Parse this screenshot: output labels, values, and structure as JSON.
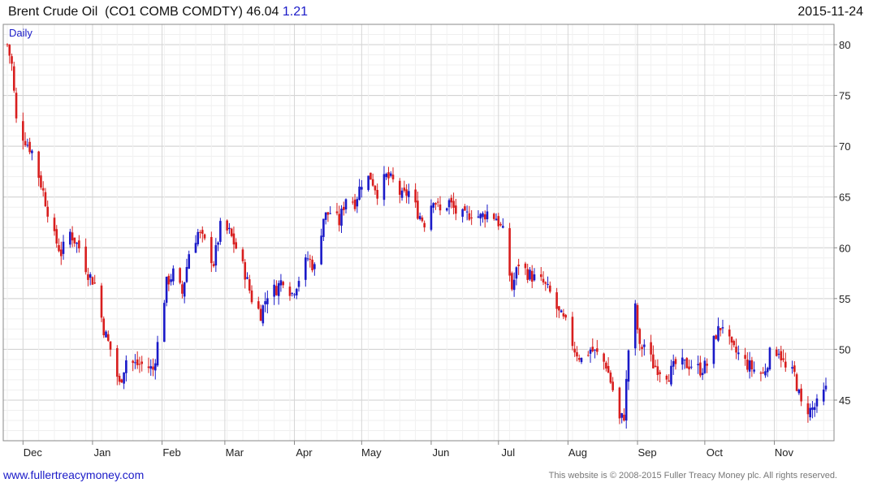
{
  "header": {
    "instrument": "Brent Crude Oil",
    "ticker": "(CO1 COMB COMDTY)",
    "last": "46.04",
    "change": "1.21",
    "date": "2015-11-24"
  },
  "footer": {
    "site": "www.fullertreacymoney.com",
    "copyright": "This website is © 2008-2015 Fuller Treacy Money plc. All rights reserved."
  },
  "colors": {
    "up": "#1a1ac8",
    "down": "#d81e1e",
    "grid": "#dddddd",
    "border": "#888888"
  },
  "chart_data": {
    "type": "candlestick",
    "interval_label": "Daily",
    "x_range": [
      "2014-11-24",
      "2015-11-24"
    ],
    "ylim": [
      41,
      82
    ],
    "yticks": [
      45,
      50,
      55,
      60,
      65,
      70,
      75,
      80
    ],
    "months": [
      {
        "label": "Dec",
        "date": "2014-12-01"
      },
      {
        "label": "Jan",
        "date": "2015-01-01"
      },
      {
        "label": "Feb",
        "date": "2015-02-01"
      },
      {
        "label": "Mar",
        "date": "2015-03-01"
      },
      {
        "label": "Apr",
        "date": "2015-04-01"
      },
      {
        "label": "May",
        "date": "2015-05-01"
      },
      {
        "label": "Jun",
        "date": "2015-06-01"
      },
      {
        "label": "Jul",
        "date": "2015-07-01"
      },
      {
        "label": "Aug",
        "date": "2015-08-01"
      },
      {
        "label": "Sep",
        "date": "2015-09-01"
      },
      {
        "label": "Oct",
        "date": "2015-10-01"
      },
      {
        "label": "Nov",
        "date": "2015-11-01"
      }
    ],
    "close_path": [
      [
        "2014-11-24",
        80.0
      ],
      [
        "2014-11-26",
        78.0
      ],
      [
        "2014-11-28",
        72.5
      ],
      [
        "2014-12-01",
        71.0
      ],
      [
        "2014-12-05",
        69.5
      ],
      [
        "2014-12-10",
        65.5
      ],
      [
        "2014-12-15",
        61.0
      ],
      [
        "2014-12-18",
        59.5
      ],
      [
        "2014-12-22",
        61.5
      ],
      [
        "2014-12-26",
        60.0
      ],
      [
        "2014-12-30",
        57.5
      ],
      [
        "2015-01-02",
        56.5
      ],
      [
        "2015-01-06",
        52.0
      ],
      [
        "2015-01-09",
        50.0
      ],
      [
        "2015-01-13",
        46.5
      ],
      [
        "2015-01-16",
        49.0
      ],
      [
        "2015-01-20",
        48.5
      ],
      [
        "2015-01-24",
        48.5
      ],
      [
        "2015-01-28",
        48.0
      ],
      [
        "2015-01-30",
        50.5
      ],
      [
        "2015-02-03",
        56.5
      ],
      [
        "2015-02-06",
        57.5
      ],
      [
        "2015-02-10",
        55.5
      ],
      [
        "2015-02-13",
        59.5
      ],
      [
        "2015-02-17",
        61.5
      ],
      [
        "2015-02-20",
        60.5
      ],
      [
        "2015-02-24",
        58.5
      ],
      [
        "2015-02-27",
        62.0
      ],
      [
        "2015-03-03",
        61.5
      ],
      [
        "2015-03-06",
        60.0
      ],
      [
        "2015-03-10",
        57.5
      ],
      [
        "2015-03-13",
        55.0
      ],
      [
        "2015-03-17",
        53.5
      ],
      [
        "2015-03-20",
        55.5
      ],
      [
        "2015-03-24",
        56.0
      ],
      [
        "2015-03-27",
        57.0
      ],
      [
        "2015-03-31",
        55.5
      ],
      [
        "2015-04-03",
        57.0
      ],
      [
        "2015-04-07",
        59.0
      ],
      [
        "2015-04-10",
        58.0
      ],
      [
        "2015-04-14",
        63.0
      ],
      [
        "2015-04-17",
        63.5
      ],
      [
        "2015-04-21",
        62.5
      ],
      [
        "2015-04-24",
        65.0
      ],
      [
        "2015-04-28",
        64.5
      ],
      [
        "2015-05-01",
        66.5
      ],
      [
        "2015-05-05",
        67.0
      ],
      [
        "2015-05-08",
        65.5
      ],
      [
        "2015-05-12",
        67.0
      ],
      [
        "2015-05-15",
        66.5
      ],
      [
        "2015-05-19",
        65.0
      ],
      [
        "2015-05-22",
        65.5
      ],
      [
        "2015-05-26",
        63.5
      ],
      [
        "2015-05-29",
        62.5
      ],
      [
        "2015-06-02",
        65.0
      ],
      [
        "2015-06-05",
        63.5
      ],
      [
        "2015-06-09",
        64.5
      ],
      [
        "2015-06-12",
        63.5
      ],
      [
        "2015-06-16",
        63.0
      ],
      [
        "2015-06-19",
        63.5
      ],
      [
        "2015-06-23",
        63.0
      ],
      [
        "2015-06-26",
        63.5
      ],
      [
        "2015-06-30",
        63.0
      ],
      [
        "2015-07-03",
        61.5
      ],
      [
        "2015-07-07",
        56.0
      ],
      [
        "2015-07-10",
        58.5
      ],
      [
        "2015-07-14",
        57.5
      ],
      [
        "2015-07-17",
        57.0
      ],
      [
        "2015-07-21",
        56.5
      ],
      [
        "2015-07-24",
        55.5
      ],
      [
        "2015-07-28",
        53.5
      ],
      [
        "2015-07-31",
        52.5
      ],
      [
        "2015-08-04",
        50.0
      ],
      [
        "2015-08-07",
        49.0
      ],
      [
        "2015-08-11",
        50.0
      ],
      [
        "2015-08-14",
        49.5
      ],
      [
        "2015-08-18",
        48.5
      ],
      [
        "2015-08-21",
        46.0
      ],
      [
        "2015-08-24",
        43.0
      ],
      [
        "2015-08-26",
        43.5
      ],
      [
        "2015-08-28",
        50.0
      ],
      [
        "2015-08-31",
        54.0
      ],
      [
        "2015-09-02",
        50.0
      ],
      [
        "2015-09-04",
        50.5
      ],
      [
        "2015-09-08",
        48.5
      ],
      [
        "2015-09-11",
        48.0
      ],
      [
        "2015-09-15",
        47.5
      ],
      [
        "2015-09-18",
        48.5
      ],
      [
        "2015-09-22",
        48.5
      ],
      [
        "2015-09-25",
        48.5
      ],
      [
        "2015-09-29",
        48.0
      ],
      [
        "2015-10-02",
        48.5
      ],
      [
        "2015-10-06",
        51.5
      ],
      [
        "2015-10-09",
        52.5
      ],
      [
        "2015-10-13",
        50.0
      ],
      [
        "2015-10-16",
        49.5
      ],
      [
        "2015-10-20",
        48.5
      ],
      [
        "2015-10-23",
        48.0
      ],
      [
        "2015-10-27",
        47.5
      ],
      [
        "2015-10-30",
        49.5
      ],
      [
        "2015-11-03",
        50.0
      ],
      [
        "2015-11-06",
        48.0
      ],
      [
        "2015-11-10",
        47.5
      ],
      [
        "2015-11-13",
        44.5
      ],
      [
        "2015-11-17",
        44.0
      ],
      [
        "2015-11-20",
        44.5
      ],
      [
        "2015-11-24",
        46.0
      ]
    ]
  }
}
